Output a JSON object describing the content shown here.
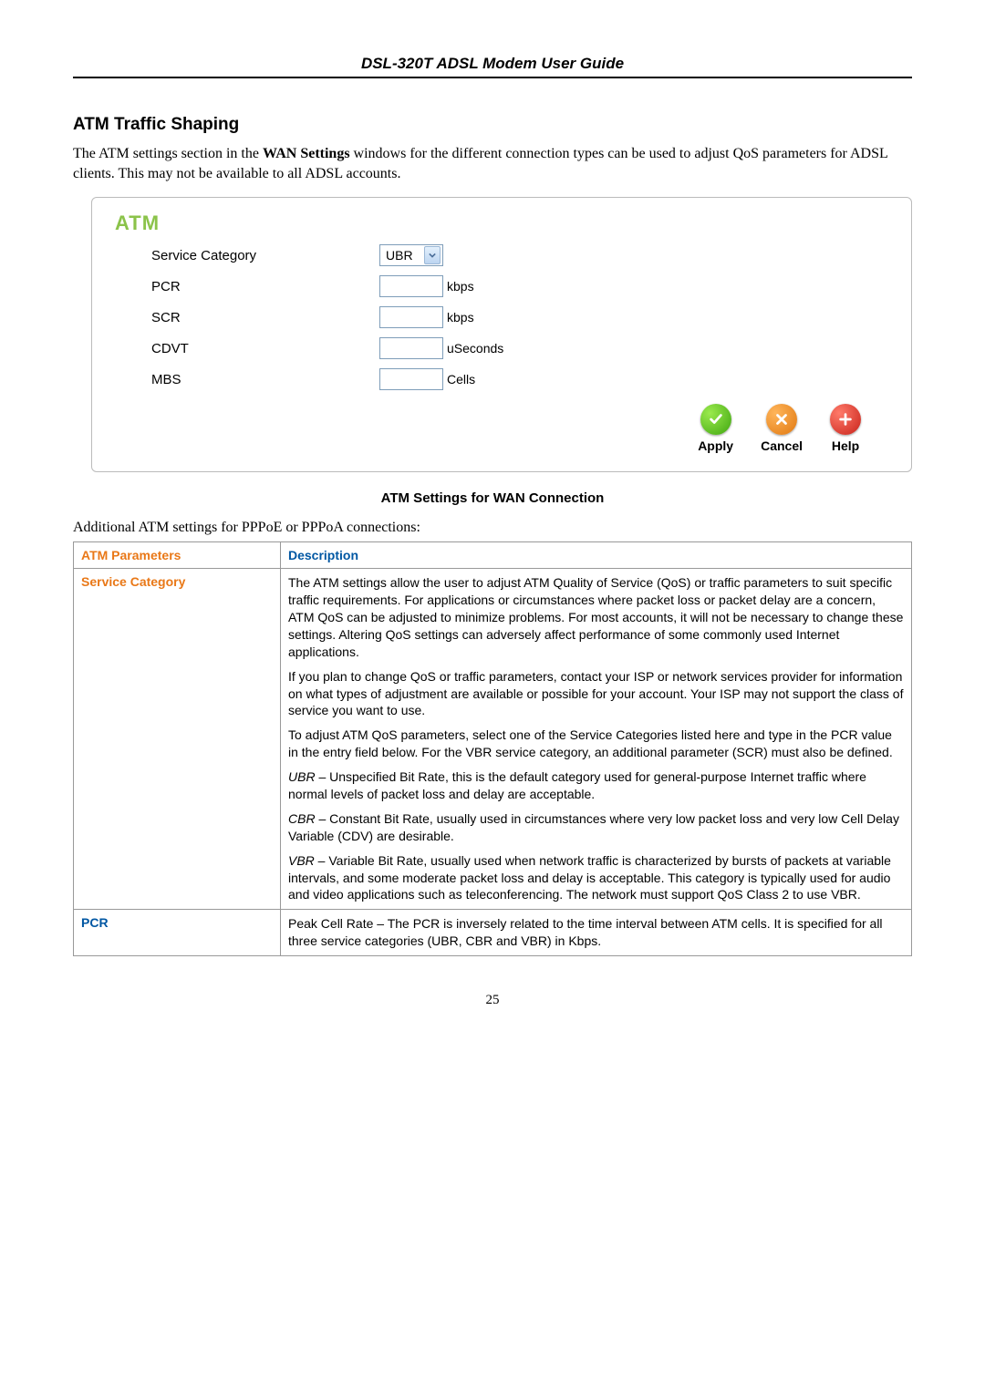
{
  "header": "DSL-320T ADSL Modem User Guide",
  "section_title": "ATM Traffic Shaping",
  "intro_prefix": "The ATM settings section in the ",
  "intro_bold": "WAN Settings",
  "intro_suffix": " windows for the different connection types can be used to adjust QoS parameters for ADSL clients. This may not be available to all ADSL accounts.",
  "atm_box": {
    "title": "ATM",
    "rows": [
      {
        "label": "Service Category",
        "type": "select",
        "value": "UBR",
        "unit": ""
      },
      {
        "label": "PCR",
        "type": "input",
        "unit": "kbps"
      },
      {
        "label": "SCR",
        "type": "input",
        "unit": "kbps"
      },
      {
        "label": "CDVT",
        "type": "input",
        "unit": "uSeconds"
      },
      {
        "label": "MBS",
        "type": "input",
        "unit": "Cells"
      }
    ],
    "buttons": {
      "apply": "Apply",
      "cancel": "Cancel",
      "help": "Help"
    }
  },
  "caption": "ATM Settings for WAN Connection",
  "sub": "Additional ATM settings for PPPoE or PPPoA connections:",
  "table": {
    "head_param": "ATM Parameters",
    "head_desc": "Description",
    "service_category_label": "Service Category",
    "sc_p1": "The ATM settings allow the user to adjust ATM Quality of Service (QoS) or traffic parameters to suit specific traffic requirements. For applications or circumstances where packet loss or packet delay are a concern, ATM QoS can be adjusted to minimize problems. For most accounts, it will not be necessary to change these settings. Altering QoS settings can adversely affect performance of some commonly used Internet applications.",
    "sc_p2": "If you plan to change QoS or traffic parameters, contact your ISP or network services provider for information on what types of adjustment are available or possible for your account. Your ISP may not support the class of service you want to use.",
    "sc_p3": "To adjust ATM QoS parameters, select one of the Service Categories listed here and type in the PCR value in the entry field below. For the VBR service category, an additional parameter (SCR) must also be defined.",
    "sc_ubr_em": "UBR",
    "sc_ubr_rest": " – Unspecified Bit Rate, this is the default category used for general-purpose Internet traffic where normal levels of packet loss and delay are acceptable.",
    "sc_cbr_em": "CBR",
    "sc_cbr_rest": " – Constant Bit Rate, usually used in circumstances where very low packet loss and very low Cell Delay Variable (CDV) are desirable.",
    "sc_vbr_em": "VBR",
    "sc_vbr_rest": " – Variable Bit Rate, usually used when network traffic is characterized by bursts of packets at variable intervals, and some moderate packet loss and delay is acceptable. This category is typically used for audio and video applications such as teleconferencing. The network must support QoS Class 2 to use VBR.",
    "pcr_label": "PCR",
    "pcr_desc": "Peak Cell Rate – The PCR is inversely related to the time interval between ATM cells. It is specified for all three service categories (UBR, CBR and VBR) in Kbps."
  },
  "page_number": "25"
}
